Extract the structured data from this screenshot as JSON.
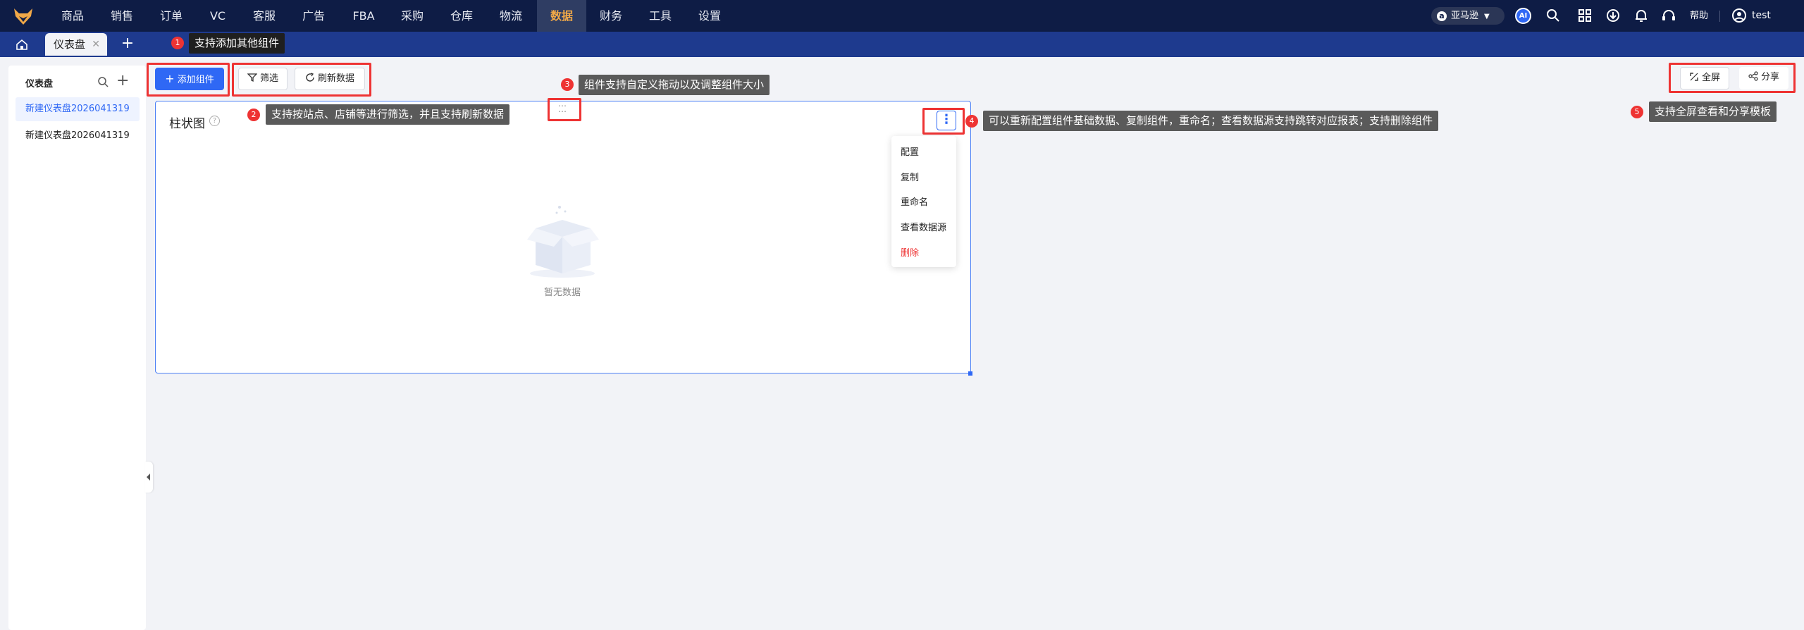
{
  "topnav": {
    "items": [
      "商品",
      "销售",
      "订单",
      "VC",
      "客服",
      "广告",
      "FBA",
      "采购",
      "仓库",
      "物流",
      "数据",
      "财务",
      "工具",
      "设置"
    ],
    "active_index": 10,
    "marketplace": "亚马逊",
    "ai_label": "AI",
    "help": "帮助",
    "user": "test",
    "icons": [
      "search-icon",
      "grid-icon",
      "download-icon",
      "bell-icon",
      "headset-icon",
      "user-icon"
    ]
  },
  "tabs": {
    "active": "仪表盘",
    "add": "+"
  },
  "sidebar": {
    "title": "仪表盘",
    "items": [
      "新建仪表盘2026041319",
      "新建仪表盘2026041319"
    ]
  },
  "toolbar": {
    "add_widget": "添加组件",
    "filter": "筛选",
    "refresh": "刷新数据",
    "fullscreen": "全屏",
    "share": "分享"
  },
  "widget": {
    "title": "柱状图",
    "help": "?",
    "empty": "暂无数据",
    "menu": [
      "配置",
      "复制",
      "重命名",
      "查看数据源",
      "删除"
    ]
  },
  "tips": [
    {
      "n": "1",
      "text": "支持添加其他组件"
    },
    {
      "n": "2",
      "text": "支持按站点、店铺等进行筛选，并且支持刷新数据"
    },
    {
      "n": "3",
      "text": "组件支持自定义拖动以及调整组件大小"
    },
    {
      "n": "4",
      "text": "可以重新配置组件基础数据、复制组件，重命名；查看数据源支持跳转对应报表；支持删除组件"
    },
    {
      "n": "5",
      "text": "支持全屏查看和分享模板"
    }
  ],
  "colors": {
    "nav": "#0e1c45",
    "tabbar": "#1e3a8e",
    "accent": "#2f68f5",
    "active_nav": "#f0a848",
    "danger": "#e33"
  }
}
